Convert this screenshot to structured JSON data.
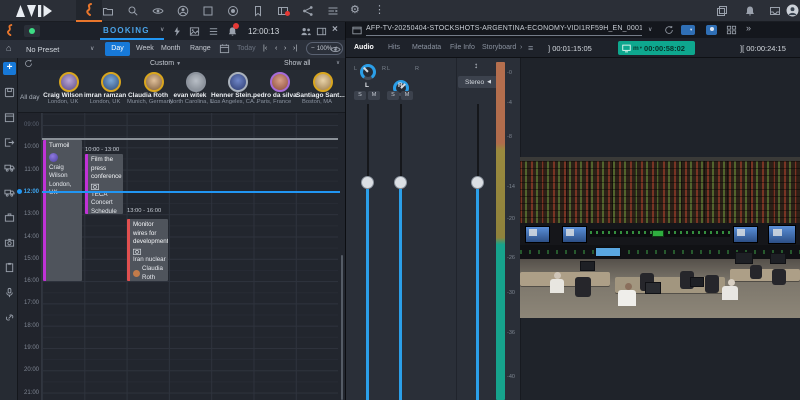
{
  "icons": {
    "chevron_down": "∨",
    "filter": "▼",
    "kebab": "⋮",
    "gear": "⚙",
    "home": "⌂",
    "add": "+",
    "close": "×",
    "menu": "≡",
    "double_chevron": "»",
    "arrow_right": "›",
    "nav_first": "|‹",
    "nav_prev": "‹",
    "nav_next": "›",
    "nav_last": "›|",
    "zoom_out": "−",
    "zoom_in": "+",
    "pan_updown": "↕",
    "speaker": "◀",
    "mark_in_bracket": "]",
    "duration_bracket": "][",
    "caret": "▾"
  },
  "top_bar": {
    "clock": "12:00:13"
  },
  "booking": {
    "tab_label": "BOOKING",
    "preset": "No Preset",
    "views": {
      "day": "Day",
      "week": "Week",
      "month": "Month",
      "range": "Range"
    },
    "today": "Today",
    "zoom": "100%",
    "filter": "Custom",
    "show_all": "Show all",
    "all_day": "All day",
    "current_time": "12:00",
    "people": [
      {
        "name": "Craig Wilson",
        "location": "London, UK"
      },
      {
        "name": "imran ramzan",
        "location": "London, UK"
      },
      {
        "name": "Claudia Roth",
        "location": "Munich, Germany"
      },
      {
        "name": "evan witek",
        "location": "North Carolina, U..."
      },
      {
        "name": "Henner Stein...",
        "location": "Los Angeles, CA..."
      },
      {
        "name": "pedro da silva",
        "location": "Paris, France"
      },
      {
        "name": "Santiago Sant...",
        "location": "Boston, MA"
      }
    ],
    "hours": [
      "09:00",
      "10:00",
      "11:00",
      "13:00",
      "14:00",
      "15:00",
      "16:00",
      "17:00",
      "18:00",
      "19:00",
      "20:00",
      "21:00"
    ],
    "events": {
      "turmoil": {
        "title": "Turmoil",
        "person": "Craig Wilson",
        "location": "London, UK"
      },
      "film": {
        "time": "10:00 - 13:00",
        "title": "Film the press conference",
        "item": "TECA Concert Schedule Preview"
      },
      "monitor": {
        "time": "13:00 - 16:00",
        "title": "Monitor wires for developments",
        "item": "Iran nuclear",
        "person": "Claudia Roth"
      }
    }
  },
  "player": {
    "title": "AFP-TV-20250404-STOCKSHOTS-ARGENTINA-ECONOMY-VIDI1RF59H_EN_0001",
    "tabs": {
      "audio": "Audio",
      "hits": "Hits",
      "metadata": "Metadata",
      "file_info": "File Info",
      "storyboard": "Storyboard"
    },
    "mark_in": "00:01:15:05",
    "position": "00:00:58:02",
    "position_mode": "m",
    "duration": "00:00:24:15",
    "mixer": {
      "solo": "S",
      "mute": "M",
      "left": "L",
      "right": "R",
      "stereo": "Stereo",
      "meter_scale": [
        "-0",
        "-4",
        "-8",
        "-14",
        "-20",
        "-26",
        "-30",
        "-36",
        "-40"
      ]
    }
  },
  "colors": {
    "accent_blue": "#2196f3",
    "selected_pill": "#1779d8",
    "timecode_green": "#0ea78e",
    "event_magenta": "#c032d6",
    "event_red": "#e05050",
    "meter_top": "#b56f4e",
    "meter_mid": "#9a8a3e",
    "meter_low": "#16a38c",
    "app_orange": "#e8762c"
  }
}
